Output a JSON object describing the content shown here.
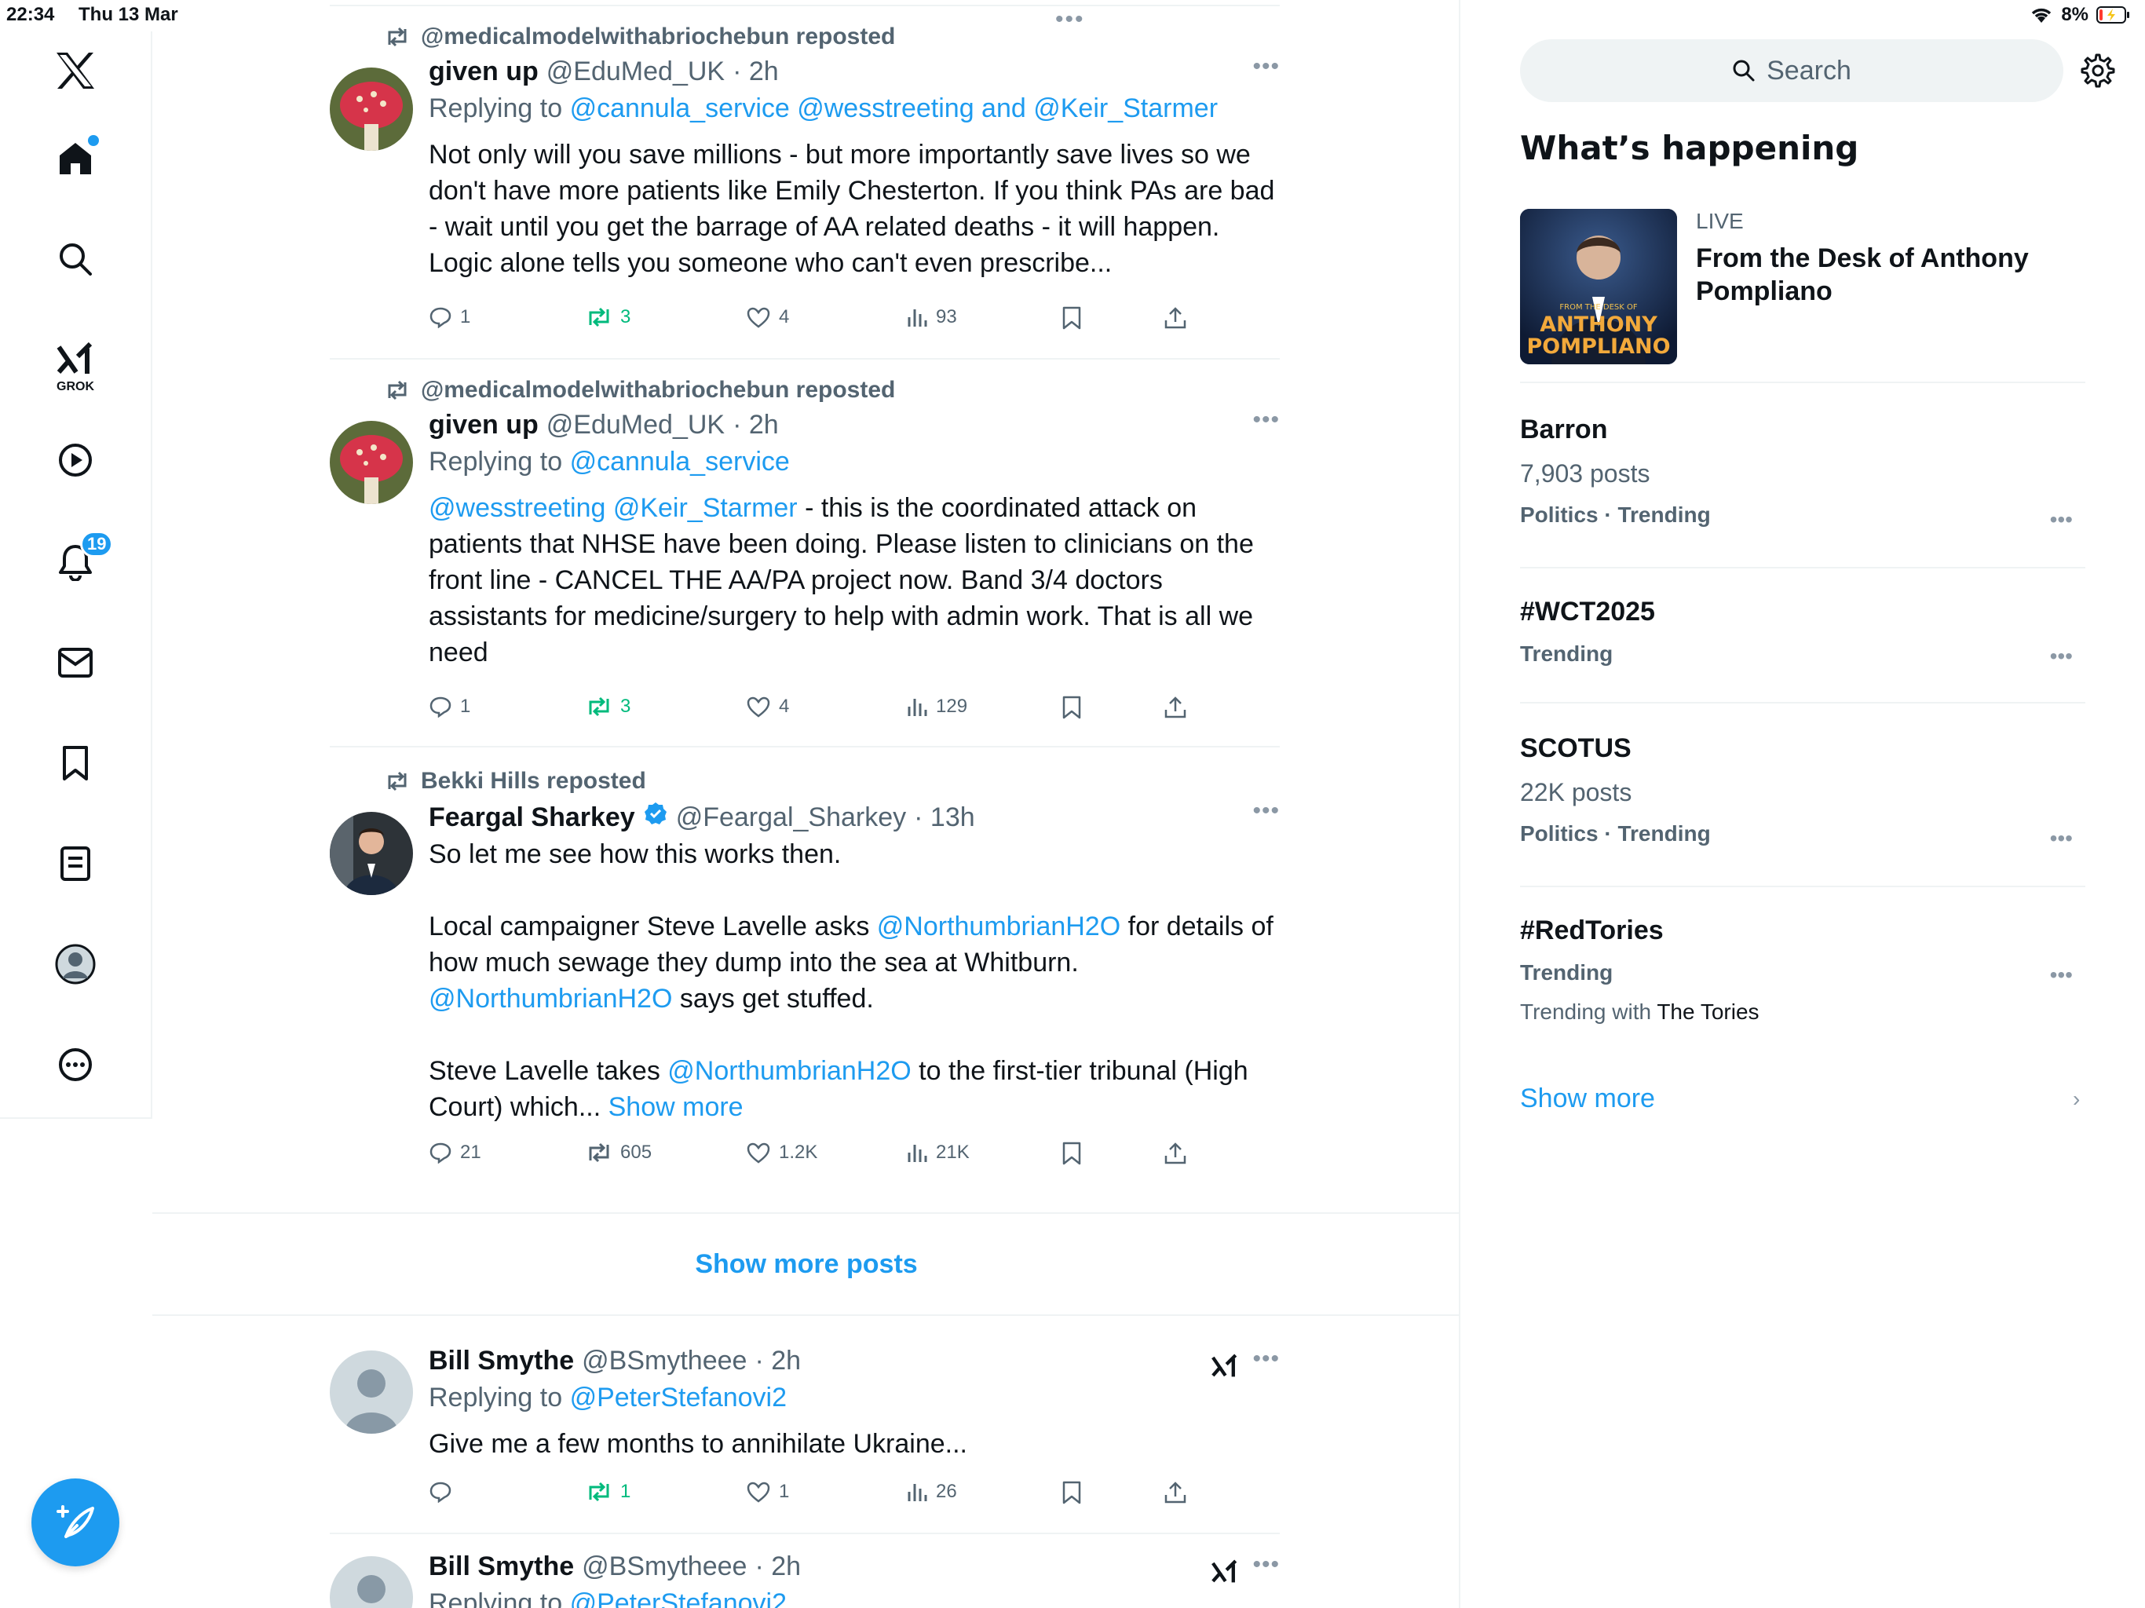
{
  "status": {
    "time": "22:34",
    "date": "Thu 13 Mar",
    "battery": "8%"
  },
  "nav": {
    "notifications_badge": "19",
    "grok_label": "GROK"
  },
  "feed": {
    "posts": [
      {
        "repost_by": "@medicalmodelwithabriochebun reposted",
        "name": "given up",
        "handle": "@EduMed_UK",
        "time": "· 2h",
        "replying_prefix": "Replying to",
        "replying_to": "@cannula_service @wesstreeting and @Keir_Starmer",
        "text": "Not only will you save millions - but more importantly save lives so we don't have more patients like Emily Chesterton. If you think PAs are bad - wait until you get the barrage of AA related deaths - it will happen. Logic alone tells you someone who can't even prescribe...",
        "replies": "1",
        "reposts": "3",
        "likes": "4",
        "views": "93"
      },
      {
        "repost_by": "@medicalmodelwithabriochebun reposted",
        "name": "given up",
        "handle": "@EduMed_UK",
        "time": "· 2h",
        "replying_prefix": "Replying to",
        "replying_to": "@cannula_service",
        "text_links": "@wesstreeting @Keir_Starmer",
        "text": " - this is the coordinated attack on patients that NHSE have been doing. Please listen to clinicians on the front line - CANCEL THE AA/PA project now. Band 3/4 doctors assistants for medicine/surgery to help with admin work. That is all we need",
        "replies": "1",
        "reposts": "3",
        "likes": "4",
        "views": "129"
      },
      {
        "repost_by": "Bekki Hills reposted",
        "name": "Feargal Sharkey",
        "handle": "@Feargal_Sharkey",
        "time": "· 13h",
        "text_1": "So let me see how this works then.",
        "text_2a": "Local campaigner Steve Lavelle asks ",
        "mention": "@NorthumbrianH2O",
        "text_2b": " for details of how much sewage they dump into the sea at Whitburn.",
        "text_2c": " says get stuffed.",
        "text_3a": "Steve Lavelle takes ",
        "text_3b": " to the first-tier tribunal (High Court) which... ",
        "show_more": "Show more",
        "replies": "21",
        "reposts": "605",
        "likes": "1.2K",
        "views": "21K"
      },
      {
        "name": "Bill Smythe",
        "handle": "@BSmytheee",
        "time": "· 2h",
        "replying_prefix": "Replying to",
        "replying_to": "@PeterStefanovi2",
        "text": "Give me a few months to annihilate Ukraine...",
        "replies": "",
        "reposts": "1",
        "likes": "1",
        "views": "26"
      },
      {
        "name": "Bill Smythe",
        "handle": "@BSmytheee",
        "time": "· 2h",
        "replying_prefix": "Replying to",
        "replying_to": "@PeterStefanovi2"
      }
    ],
    "show_more_posts": "Show more posts"
  },
  "sidebar": {
    "search_placeholder": "Search",
    "section_title": "What’s happening",
    "live": {
      "tag": "LIVE",
      "title": "From the Desk of Anthony Pompliano",
      "thumb_small": "FROM THE DESK OF",
      "thumb_line1": "ANTHONY",
      "thumb_line2": "POMPLIANO"
    },
    "trends": [
      {
        "name": "Barron",
        "posts": "7,903 posts",
        "category": "Politics · Trending"
      },
      {
        "name": "#WCT2025",
        "category": "Trending"
      },
      {
        "name": "SCOTUS",
        "posts": "22K posts",
        "category": "Politics · Trending"
      },
      {
        "name": "#RedTories",
        "category": "Trending",
        "with_prefix": "Trending with",
        "with_topic": "The Tories"
      }
    ],
    "show_more": "Show more"
  },
  "colors": {
    "accent": "#1d9bf0",
    "repost_green": "#00ba7c",
    "muted": "#536471"
  }
}
